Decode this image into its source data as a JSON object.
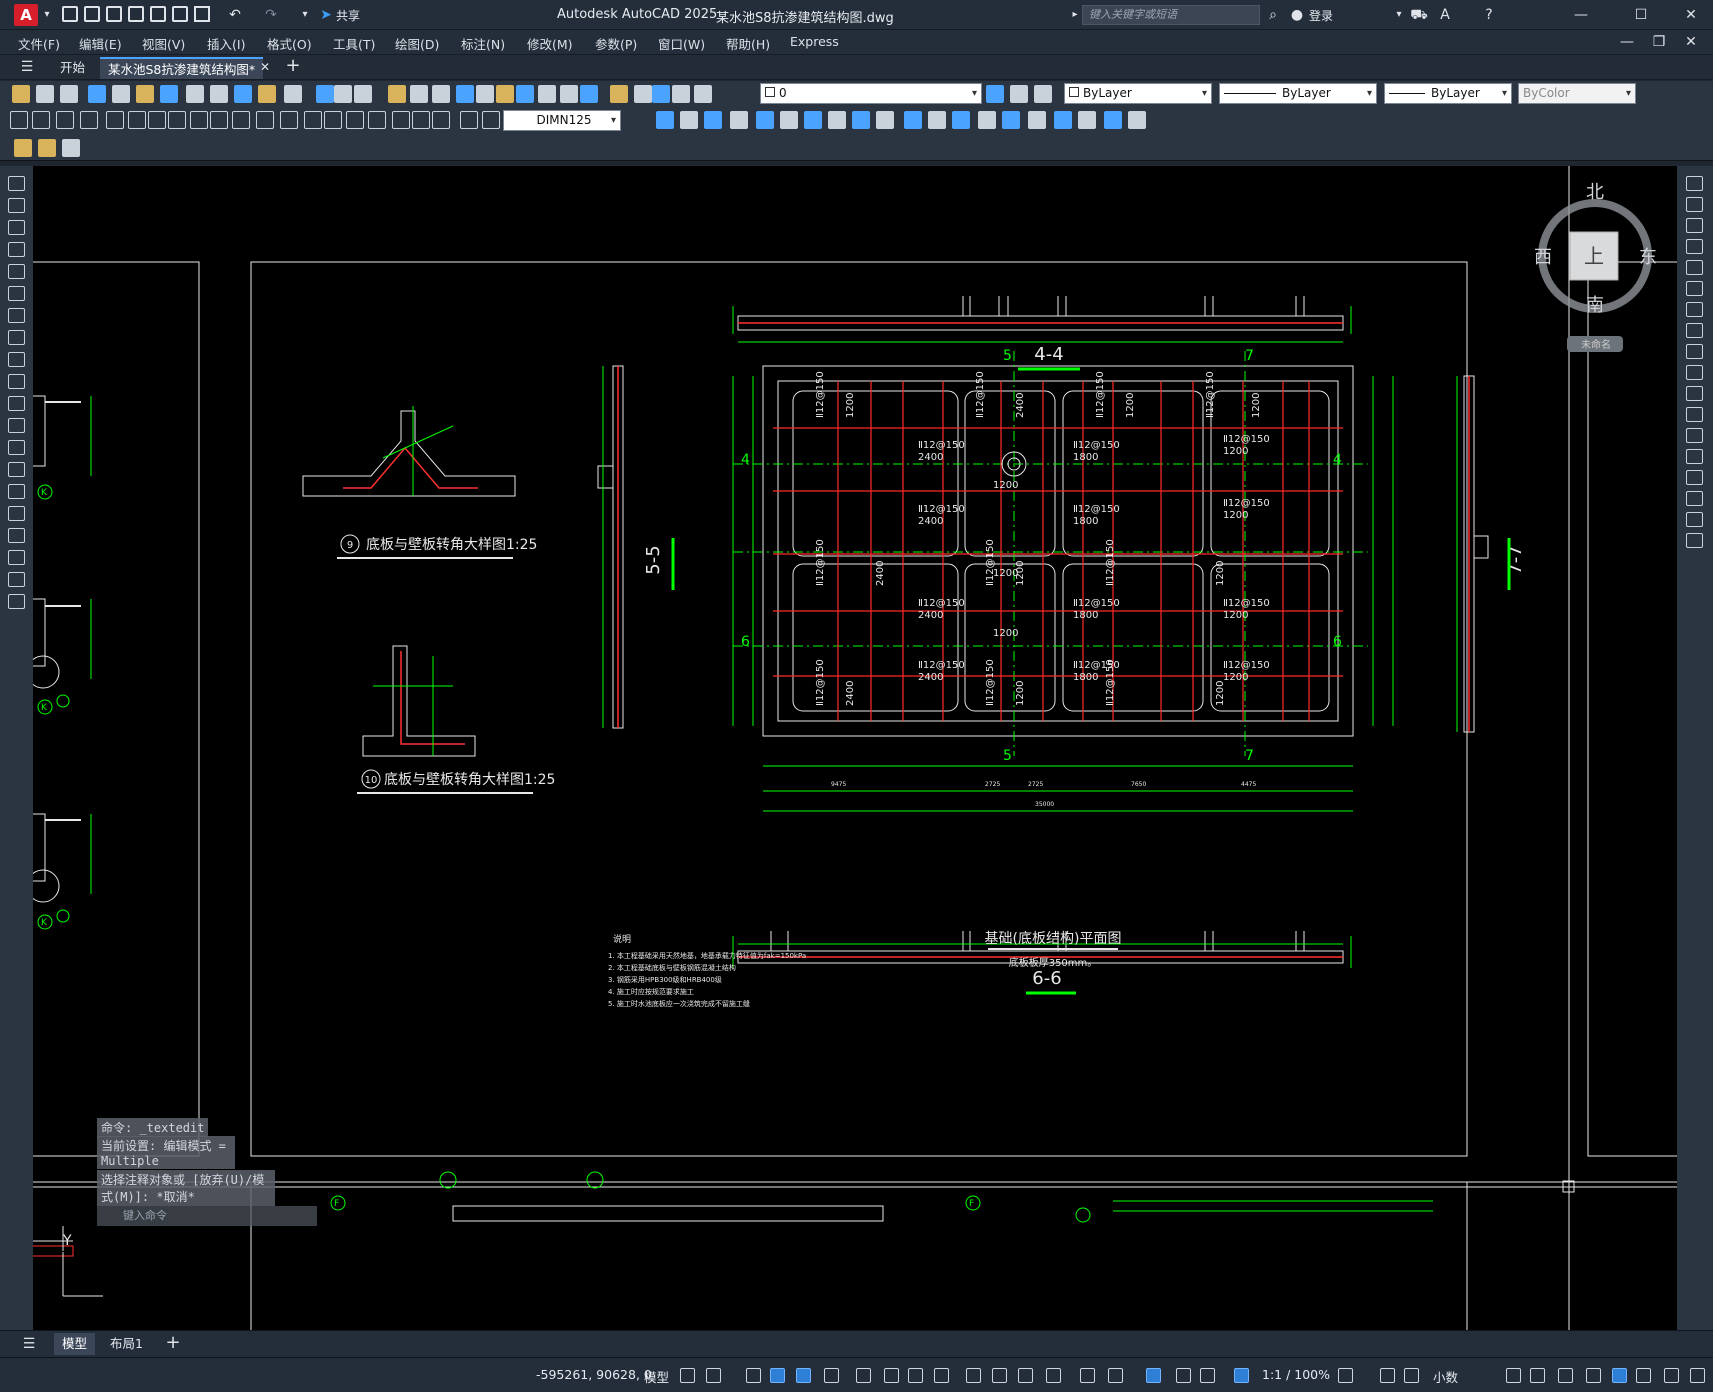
{
  "app": {
    "logo": "A",
    "title": "Autodesk AutoCAD 2025",
    "filename": "某水池S8抗渗建筑结构图.dwg",
    "share": "共享",
    "search_placeholder": "键入关键字或短语",
    "login": "登录"
  },
  "menu": [
    "文件(F)",
    "编辑(E)",
    "视图(V)",
    "插入(I)",
    "格式(O)",
    "工具(T)",
    "绘图(D)",
    "标注(N)",
    "修改(M)",
    "参数(P)",
    "窗口(W)",
    "帮助(H)",
    "Express"
  ],
  "tabs": {
    "start": "开始",
    "drawing": "某水池S8抗渗建筑结构图*"
  },
  "toolbar": {
    "layer": "0",
    "color": "ByLayer",
    "linetype": "ByLayer",
    "lineweight": "ByLayer",
    "plotstyle": "ByColor",
    "dimstyle": "DIMN125"
  },
  "viewcube": {
    "north": "北",
    "south": "南",
    "east": "东",
    "west": "西",
    "top": "上",
    "wcs": "未命名"
  },
  "drawing": {
    "section_44": "4-4",
    "section_55": "5-5",
    "section_66": "6-6",
    "section_77": "7-7",
    "detail9": "底板与壁板转角大样图1:25",
    "detail9_no": "9",
    "detail10": "底板与壁板转角大样图1:25",
    "detail10_no": "10",
    "plan_title": "基础(底板结构)平面图",
    "plan_sub": "底板板厚350mm。",
    "notes_title": "说明",
    "notes": [
      "1. 本工程基础采用天然地基，地基承载力特征值为fak=150kPa",
      "2. 本工程基础底板与壁板钢筋混凝土结构",
      "3. 钢筋采用HPB300级和HRB400级",
      "4. 施工时应按规范要求施工",
      "5. 施工时水池底板应一次浇筑完成不留施工缝"
    ],
    "rebar_labels": [
      "Ⅱ12@150",
      "2400",
      "1800",
      "1200"
    ],
    "axis_marks": [
      "4",
      "5",
      "6",
      "7",
      "K",
      "F"
    ],
    "dims_bottom": [
      "9475",
      "2725",
      "2725",
      "7650",
      "4475",
      "35000"
    ]
  },
  "command": {
    "line1": "命令: _textedit",
    "line2": "当前设置: 编辑模式 = Multiple",
    "line3": "选择注释对象或 [放弃(U)/模式(M)]: *取消*",
    "prompt": "键入命令"
  },
  "layout_tabs": {
    "model": "模型",
    "layout1": "布局1"
  },
  "status": {
    "coords": "-595261, 90628, 0",
    "space": "模型",
    "scale": "1:1 / 100%",
    "units": "小数"
  }
}
